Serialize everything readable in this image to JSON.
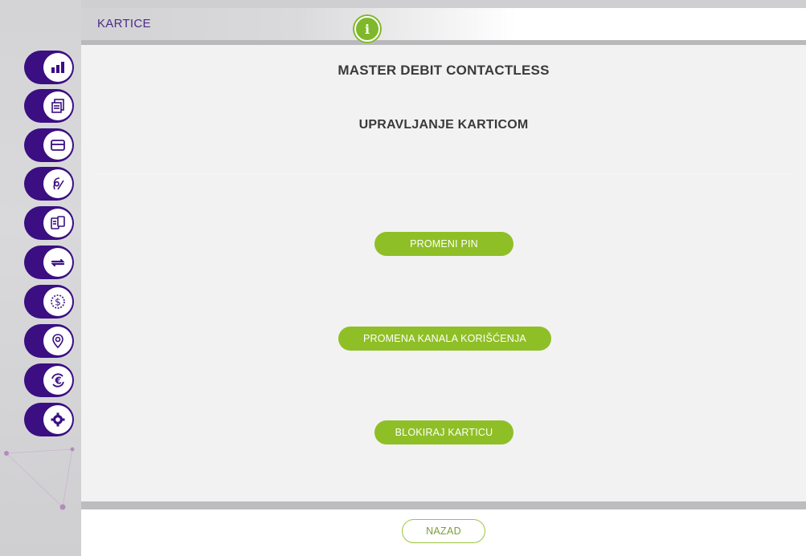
{
  "header": {
    "title": "KARTICE",
    "info_icon": "info-icon"
  },
  "sidebar": {
    "items": [
      {
        "icon": "bar-chart-icon"
      },
      {
        "icon": "documents-icon"
      },
      {
        "icon": "credit-card-icon"
      },
      {
        "icon": "signature-icon"
      },
      {
        "icon": "devices-icon"
      },
      {
        "icon": "transfer-icon"
      },
      {
        "icon": "dollar-circle-icon"
      },
      {
        "icon": "location-pin-icon"
      },
      {
        "icon": "euro-exchange-icon"
      },
      {
        "icon": "gear-icon"
      }
    ]
  },
  "main": {
    "card_title": "MASTER DEBIT CONTACTLESS",
    "section_title": "UPRAVLJANJE KARTICOM",
    "actions": {
      "change_pin": "PROMENI PIN",
      "change_channel": "PROMENA KANALA KORIŠĆENJA",
      "block_card": "BLOKIRAJ KARTICU"
    }
  },
  "footer": {
    "back_label": "NAZAD"
  },
  "colors": {
    "accent_purple": "#3b0e82",
    "accent_green": "#8fbf26",
    "title_purple": "#4b2b84"
  }
}
